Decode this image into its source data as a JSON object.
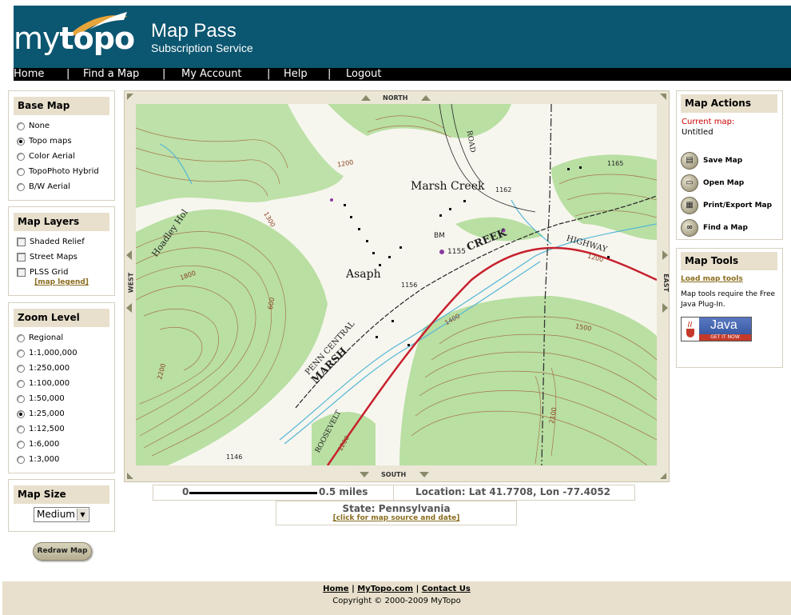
{
  "brand": {
    "logo_my": "my",
    "logo_topo": "topo",
    "title": "Map Pass",
    "subtitle": "Subscription Service"
  },
  "nav": {
    "items": [
      "Home",
      "Find a Map",
      "My Account",
      "Help",
      "Logout"
    ],
    "separator": "|"
  },
  "base_map": {
    "title": "Base Map",
    "options": [
      "None",
      "Topo maps",
      "Color Aerial",
      "TopoPhoto Hybrid",
      "B/W Aerial"
    ],
    "selected": "Topo maps"
  },
  "map_layers": {
    "title": "Map Layers",
    "options": [
      "Shaded Relief",
      "Street Maps",
      "PLSS Grid"
    ],
    "legend_link": "[map legend]"
  },
  "zoom_level": {
    "title": "Zoom Level",
    "options": [
      "Regional",
      "1:1,000,000",
      "1:250,000",
      "1:100,000",
      "1:50,000",
      "1:25,000",
      "1:12,500",
      "1:6,000",
      "1:3,000"
    ],
    "selected": "1:25,000"
  },
  "map_size": {
    "title": "Map Size",
    "selected": "Medium"
  },
  "redraw_label": "Redraw Map",
  "map": {
    "north": "NORTH",
    "south": "SOUTH",
    "east": "EAST",
    "west": "WEST",
    "labels": {
      "marsh_creek_town": "Marsh Creek",
      "asaph": "Asaph",
      "creek": "CREEK",
      "marsh": "MARSH",
      "highway": "HIGHWAY",
      "penn_central": "PENN CENTRAL",
      "roosevelt": "ROOSEVELT",
      "road": "ROAD",
      "hoadley": "Hoadley Hol",
      "bm": "BM",
      "e1155": "1155",
      "e1156": "1156",
      "e1162": "1162",
      "e1165": "1165",
      "e1200a": "1200",
      "e1200b": "1200",
      "e1200c": "1200",
      "e1300": "1300",
      "e1400": "1400",
      "e1500": "1500",
      "e1800": "1800",
      "e2100": "2100",
      "e2200": "2200",
      "e600": "600",
      "e1146": "1146"
    }
  },
  "scale": {
    "zero": "0",
    "distance": "0.5 miles",
    "location": "Location: Lat 41.7708, Lon -77.4052"
  },
  "state": {
    "text": "State: Pennsylvania",
    "link": "[click for map source and date]"
  },
  "map_actions": {
    "title": "Map Actions",
    "current_label": "Current map:",
    "current_value": "Untitled",
    "items": [
      "Save Map",
      "Open Map",
      "Print/Export Map",
      "Find a Map"
    ]
  },
  "map_tools": {
    "title": "Map Tools",
    "link": "Load map tools",
    "note": "Map tools require the Free Java Plug-In.",
    "java_word": "Java",
    "java_cta": "GET IT NOW"
  },
  "footer": {
    "links": [
      "Home",
      "MyTopo.com",
      "Contact Us"
    ],
    "separator": "|",
    "copyright": "Copyright © 2000-2009 MyTopo"
  },
  "colors": {
    "header": "#0b5670",
    "panel_head": "#e8e0cc",
    "link": "#8a6d1e",
    "map_green": "#b9dfa3",
    "contour": "#a0522d",
    "road_red": "#c8202e"
  }
}
